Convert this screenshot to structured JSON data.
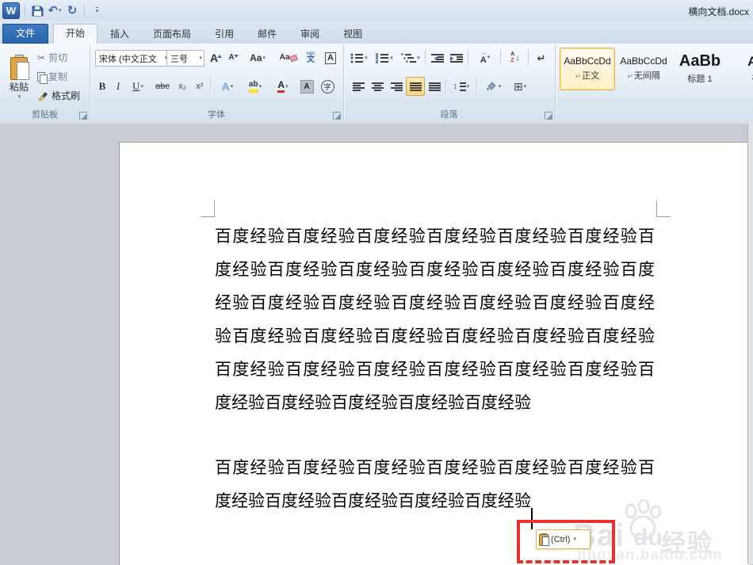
{
  "colors": {
    "accent_blue": "#2b67b1",
    "file_tab_blue": "#2763ae",
    "selection_orange": "#ffe9ae",
    "annotation_red": "#e8322b",
    "doc_background": "#c9cdd3",
    "watermark_gray": "#e3e4e7"
  },
  "titlebar": {
    "title": "横向文档.docx"
  },
  "glyphs": {
    "word_logo": "W",
    "dd": "▾",
    "undo": "↶",
    "redo": "↻",
    "cut": "✂",
    "pilcrow": "↵",
    "borders_grid": "⊞",
    "sort_a": "A",
    "sort_z": "Z",
    "sort_down": "↓",
    "asian_arrows": "↔",
    "paste_dd": "▾"
  },
  "tabs": [
    {
      "label": "文件",
      "active": false
    },
    {
      "label": "开始",
      "active": true
    },
    {
      "label": "插入",
      "active": false
    },
    {
      "label": "页面布局",
      "active": false
    },
    {
      "label": "引用",
      "active": false
    },
    {
      "label": "邮件",
      "active": false
    },
    {
      "label": "审阅",
      "active": false
    },
    {
      "label": "视图",
      "active": false
    }
  ],
  "ribbon": {
    "clipboard": {
      "group_label": "剪贴板",
      "paste_label": "粘贴",
      "cut_label": "剪切",
      "copy_label": "复制",
      "format_painter_label": "格式刷"
    },
    "font": {
      "group_label": "字体",
      "font_name": "宋体 (中文正文",
      "font_size": "三号",
      "grow_font": "A",
      "shrink_font": "A",
      "change_case": "Aa",
      "clear_formatting": "Aa",
      "phonetic_top": "wén",
      "phonetic_bottom": "文",
      "char_border": "A",
      "bold": "B",
      "italic": "I",
      "underline": "U",
      "strikethrough": "abc",
      "subscript": "x₂",
      "superscript": "x²",
      "text_effects": "A",
      "highlight": "ab",
      "font_color": "A",
      "char_shading": "A",
      "enclose": "字"
    },
    "paragraph": {
      "group_label": "段落",
      "asian_layout": "A"
    },
    "styles": [
      {
        "preview": "AaBbCcDd",
        "mark": "↵",
        "name": "正文",
        "selected": true
      },
      {
        "preview": "AaBbCcDd",
        "mark": "↵",
        "name": "无间隔",
        "selected": false
      },
      {
        "preview": "AaBb",
        "mark": "",
        "name": "标题 1",
        "selected": false
      },
      {
        "preview": "Aa",
        "mark": "",
        "name": "标",
        "selected": false
      }
    ]
  },
  "document": {
    "lines": [
      "百度经验百度经验百度经验百度经验百度经验百度经验百",
      "度经验百度经验百度经验百度经验百度经验百度经验百度",
      "经验百度经验百度经验百度经验百度经验百度经验百度经",
      "验百度经验百度经验百度经验百度经验百度经验百度经验",
      "百度经验百度经验百度经验百度经验百度经验百度经验百",
      "度经验百度经验百度经验百度经验百度经验",
      "百度经验百度经验百度经验百度经验百度经验百度经验百",
      "度经验百度经验百度经验百度经验百度经验"
    ],
    "paste_options": {
      "label": "(Ctrl)"
    },
    "watermark": {
      "brand_left": "Bai",
      "brand_right": "du",
      "brand_cn": "经验",
      "url": "jingyan.baidu.com"
    }
  }
}
